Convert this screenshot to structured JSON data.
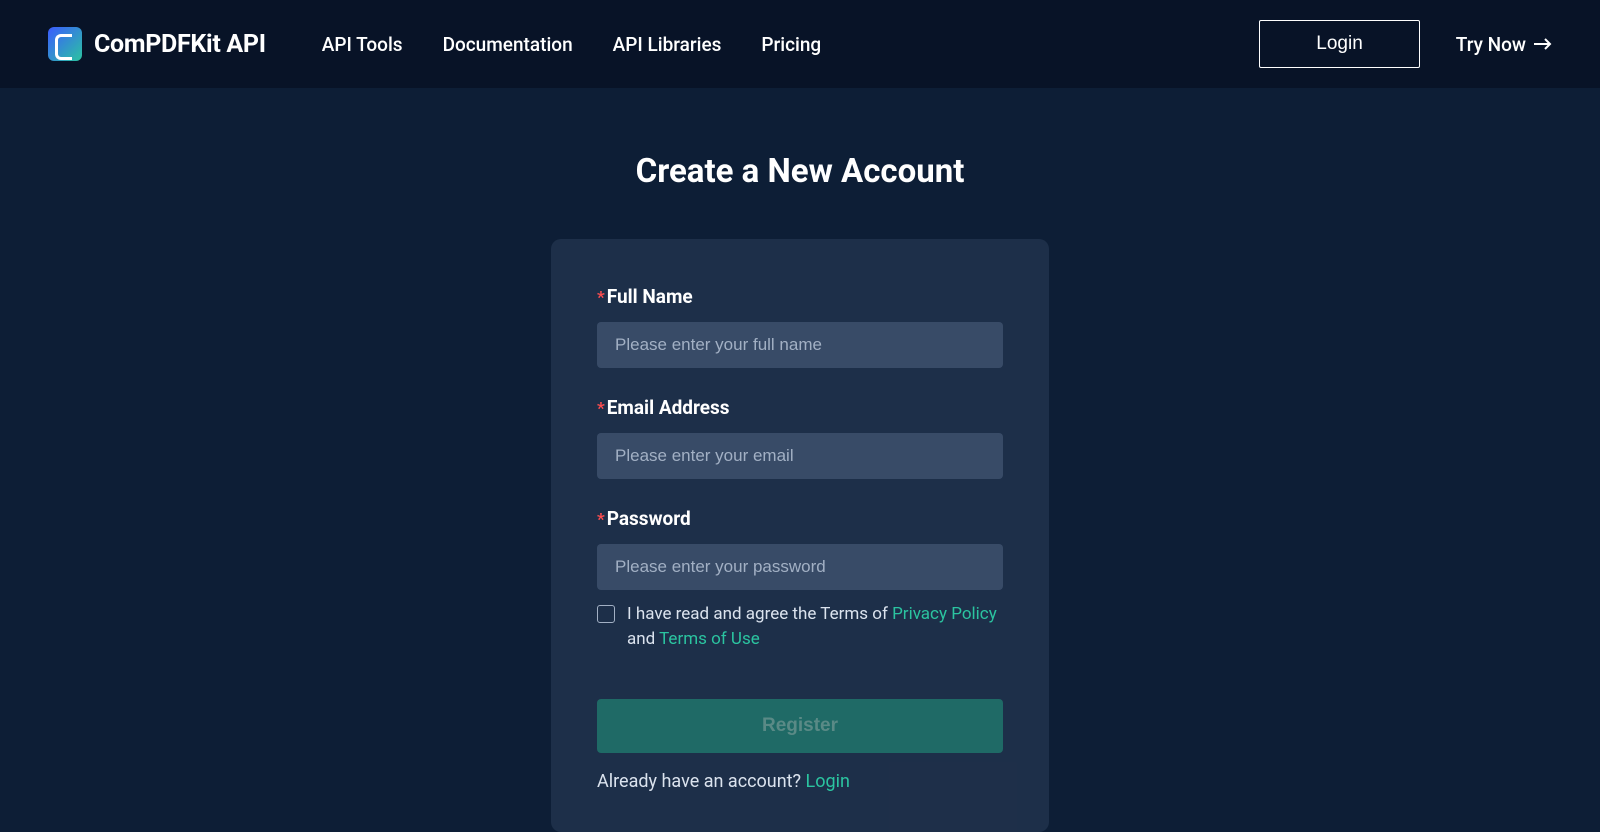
{
  "header": {
    "brand": "ComPDFKit API",
    "nav": {
      "api_tools": "API Tools",
      "documentation": "Documentation",
      "api_libraries": "API Libraries",
      "pricing": "Pricing"
    },
    "login_label": "Login",
    "try_now_label": "Try Now"
  },
  "main": {
    "title": "Create a New Account",
    "form": {
      "full_name": {
        "label": "Full Name",
        "placeholder": "Please enter your full name",
        "required": true
      },
      "email": {
        "label": "Email Address",
        "placeholder": "Please enter your email",
        "required": true
      },
      "password": {
        "label": "Password",
        "placeholder": "Please enter your password",
        "required": true
      },
      "agree": {
        "text_prefix": "I have read and agree the Terms of ",
        "privacy_link": "Privacy Policy",
        "text_mid": " and ",
        "terms_link": "Terms of Use"
      },
      "register_label": "Register",
      "already_text": "Already have an account? ",
      "already_login_link": "Login"
    }
  },
  "colors": {
    "page_bg": "#0d1e36",
    "header_bg": "#081327",
    "accent": "#2bc4a0",
    "required": "#ff4d4f"
  }
}
